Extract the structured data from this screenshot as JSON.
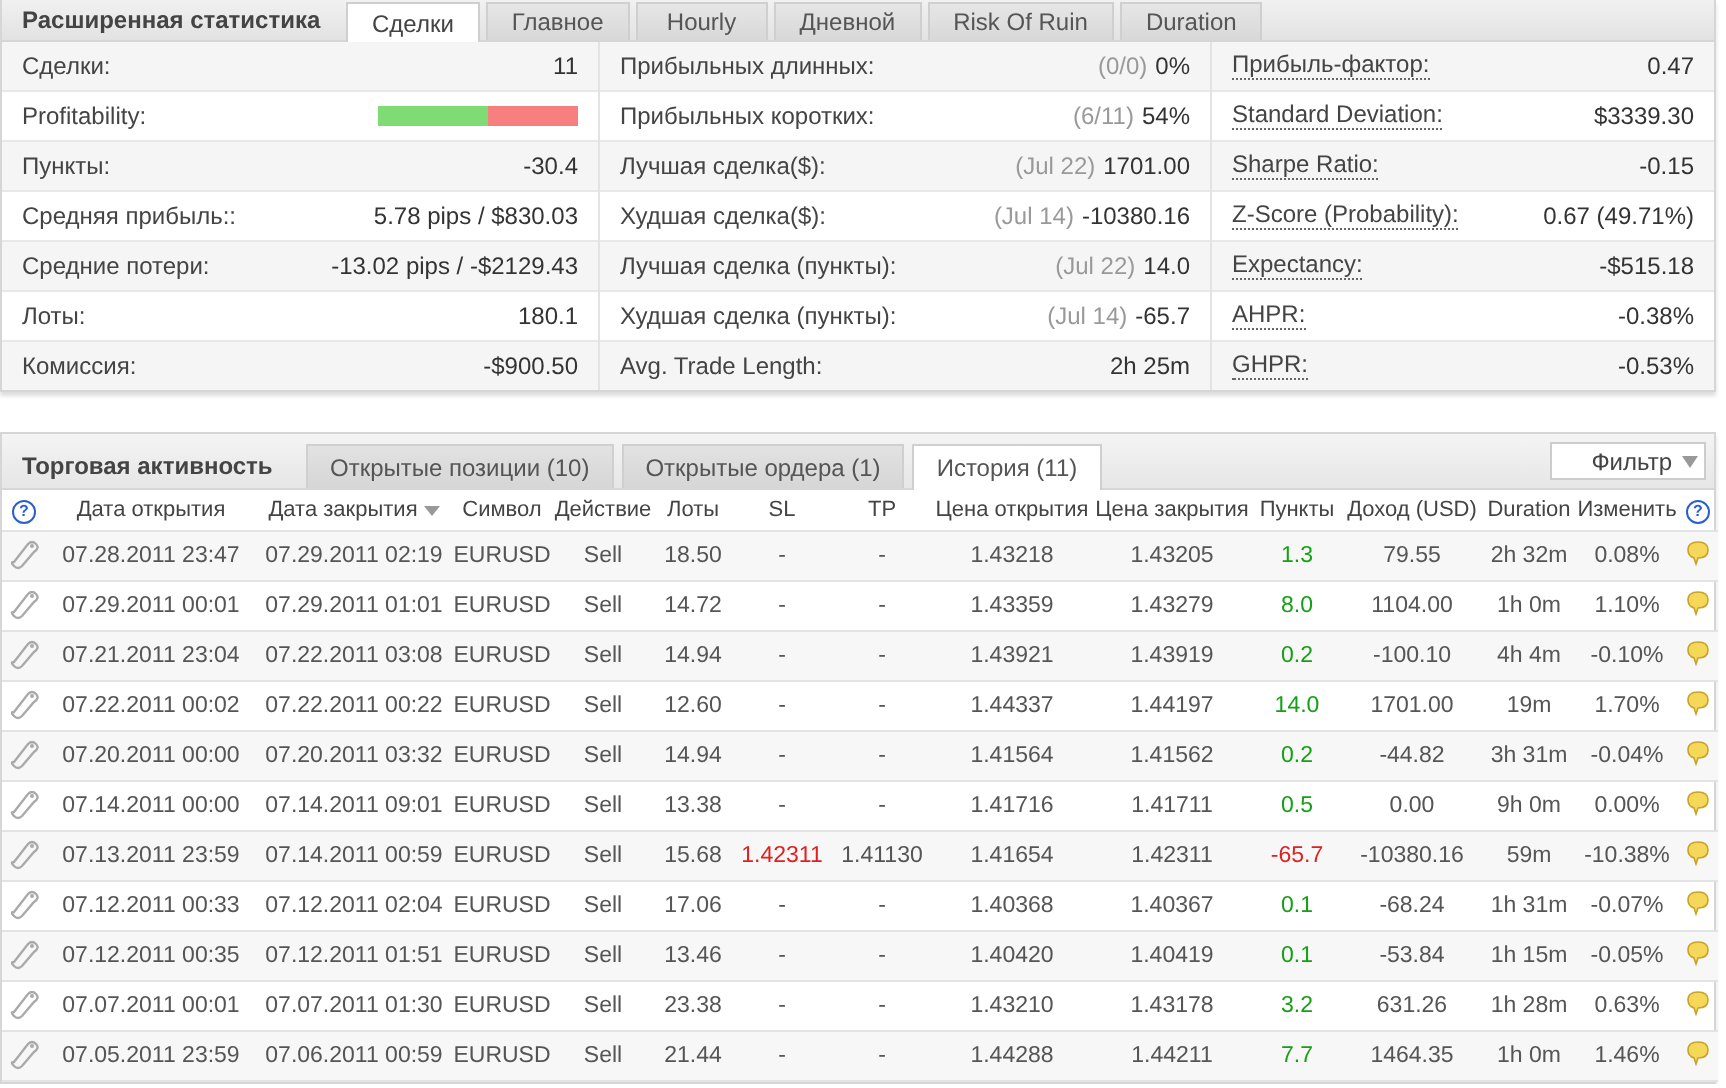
{
  "stats": {
    "title": "Расширенная статистика",
    "tabs": [
      {
        "label": "Сделки",
        "selected": true
      },
      {
        "label": "Главное",
        "selected": false
      },
      {
        "label": "Hourly",
        "selected": false
      },
      {
        "label": "Дневной",
        "selected": false
      },
      {
        "label": "Risk Of Ruin",
        "selected": false
      },
      {
        "label": "Duration",
        "selected": false
      }
    ],
    "columns": [
      {
        "items": [
          {
            "kind": "text",
            "label": "Сделки:",
            "value": "11"
          },
          {
            "kind": "bar",
            "label": "Profitability:",
            "level": 0.55
          },
          {
            "kind": "text",
            "label": "Пункты:",
            "value": "-30.4"
          },
          {
            "kind": "text",
            "label": "Средняя прибыль::",
            "value": "5.78 pips / $830.03"
          },
          {
            "kind": "text",
            "label": "Средние потери:",
            "value": "-13.02 pips / -$2129.43"
          },
          {
            "kind": "text",
            "label": "Лоты:",
            "value": "180.1"
          },
          {
            "kind": "text",
            "label": "Комиссия:",
            "value": "-$900.50"
          }
        ]
      },
      {
        "items": [
          {
            "kind": "noted",
            "label": "Прибыльных длинных:",
            "note": "(0/0)",
            "value": "0%"
          },
          {
            "kind": "noted",
            "label": "Прибыльных коротких:",
            "note": "(6/11)",
            "value": "54%"
          },
          {
            "kind": "noted",
            "label": "Лучшая сделка($):",
            "note": "(Jul 22)",
            "value": "1701.00"
          },
          {
            "kind": "noted",
            "label": "Худшая сделка($):",
            "note": "(Jul 14)",
            "value": "-10380.16"
          },
          {
            "kind": "noted",
            "label": "Лучшая сделка (пункты):",
            "note": "(Jul 22)",
            "value": "14.0"
          },
          {
            "kind": "noted",
            "label": "Худшая сделка (пункты):",
            "note": "(Jul 14)",
            "value": "-65.7"
          },
          {
            "kind": "text",
            "label": "Avg. Trade Length:",
            "value": "2h 25m"
          }
        ]
      },
      {
        "items": [
          {
            "kind": "hint",
            "label": "Прибыль-фактор:",
            "value": "0.47"
          },
          {
            "kind": "hint",
            "label": "Standard Deviation:",
            "value": "$3339.30"
          },
          {
            "kind": "hint",
            "label": "Sharpe Ratio:",
            "value": "-0.15"
          },
          {
            "kind": "hint",
            "label": "Z-Score (Probability):",
            "value": "0.67 (49.71%)"
          },
          {
            "kind": "hint",
            "label": "Expectancy:",
            "value": "-$515.18"
          },
          {
            "kind": "hint",
            "label": "AHPR:",
            "value": "-0.38%"
          },
          {
            "kind": "hint",
            "label": "GHPR:",
            "value": "-0.53%"
          }
        ]
      }
    ]
  },
  "trading": {
    "title": "Торговая активность",
    "tabs": [
      {
        "label": "Открытые позиции (10)",
        "selected": false
      },
      {
        "label": "Открытые ордера (1)",
        "selected": false
      },
      {
        "label": "История (11)",
        "selected": true
      }
    ],
    "filter": "Фильтр",
    "help_icons": [
      "?",
      "?"
    ],
    "columns": [
      {
        "label": "Дата открытия",
        "sorted": false
      },
      {
        "label": "Дата закрытия",
        "sorted": true
      },
      {
        "label": "Символ",
        "sorted": false
      },
      {
        "label": "Действие",
        "sorted": false
      },
      {
        "label": "Лоты",
        "sorted": false
      },
      {
        "label": "SL",
        "sorted": false
      },
      {
        "label": "TP",
        "sorted": false
      },
      {
        "label": "Цена открытия",
        "sorted": false
      },
      {
        "label": "Цена закрытия",
        "sorted": false
      },
      {
        "label": "Пункты",
        "sorted": false
      },
      {
        "label": "Доход (USD)",
        "sorted": false
      },
      {
        "label": "Duration",
        "sorted": false
      },
      {
        "label": "Изменить",
        "sorted": false
      }
    ],
    "rows": [
      {
        "open": "07.28.2011 23:47",
        "close": "07.29.2011 02:19",
        "symbol": "EURUSD",
        "action": "Sell",
        "lots": "18.50",
        "sl": "-",
        "tp": "-",
        "open_price": "1.43218",
        "close_price": "1.43205",
        "pips": "1.3",
        "income": "79.55",
        "duration": "2h 32m",
        "change": "0.08%",
        "profit": true,
        "sl_hit": false
      },
      {
        "open": "07.29.2011 00:01",
        "close": "07.29.2011 01:01",
        "symbol": "EURUSD",
        "action": "Sell",
        "lots": "14.72",
        "sl": "-",
        "tp": "-",
        "open_price": "1.43359",
        "close_price": "1.43279",
        "pips": "8.0",
        "income": "1104.00",
        "duration": "1h 0m",
        "change": "1.10%",
        "profit": true,
        "sl_hit": false
      },
      {
        "open": "07.21.2011 23:04",
        "close": "07.22.2011 03:08",
        "symbol": "EURUSD",
        "action": "Sell",
        "lots": "14.94",
        "sl": "-",
        "tp": "-",
        "open_price": "1.43921",
        "close_price": "1.43919",
        "pips": "0.2",
        "income": "-100.10",
        "duration": "4h 4m",
        "change": "-0.10%",
        "profit": true,
        "sl_hit": false
      },
      {
        "open": "07.22.2011 00:02",
        "close": "07.22.2011 00:22",
        "symbol": "EURUSD",
        "action": "Sell",
        "lots": "12.60",
        "sl": "-",
        "tp": "-",
        "open_price": "1.44337",
        "close_price": "1.44197",
        "pips": "14.0",
        "income": "1701.00",
        "duration": "19m",
        "change": "1.70%",
        "profit": true,
        "sl_hit": false
      },
      {
        "open": "07.20.2011 00:00",
        "close": "07.20.2011 03:32",
        "symbol": "EURUSD",
        "action": "Sell",
        "lots": "14.94",
        "sl": "-",
        "tp": "-",
        "open_price": "1.41564",
        "close_price": "1.41562",
        "pips": "0.2",
        "income": "-44.82",
        "duration": "3h 31m",
        "change": "-0.04%",
        "profit": true,
        "sl_hit": false
      },
      {
        "open": "07.14.2011 00:00",
        "close": "07.14.2011 09:01",
        "symbol": "EURUSD",
        "action": "Sell",
        "lots": "13.38",
        "sl": "-",
        "tp": "-",
        "open_price": "1.41716",
        "close_price": "1.41711",
        "pips": "0.5",
        "income": "0.00",
        "duration": "9h 0m",
        "change": "0.00%",
        "profit": true,
        "sl_hit": false
      },
      {
        "open": "07.13.2011 23:59",
        "close": "07.14.2011 00:59",
        "symbol": "EURUSD",
        "action": "Sell",
        "lots": "15.68",
        "sl": "1.42311",
        "tp": "1.41130",
        "open_price": "1.41654",
        "close_price": "1.42311",
        "pips": "-65.7",
        "income": "-10380.16",
        "duration": "59m",
        "change": "-10.38%",
        "profit": false,
        "sl_hit": true
      },
      {
        "open": "07.12.2011 00:33",
        "close": "07.12.2011 02:04",
        "symbol": "EURUSD",
        "action": "Sell",
        "lots": "17.06",
        "sl": "-",
        "tp": "-",
        "open_price": "1.40368",
        "close_price": "1.40367",
        "pips": "0.1",
        "income": "-68.24",
        "duration": "1h 31m",
        "change": "-0.07%",
        "profit": true,
        "sl_hit": false
      },
      {
        "open": "07.12.2011 00:35",
        "close": "07.12.2011 01:51",
        "symbol": "EURUSD",
        "action": "Sell",
        "lots": "13.46",
        "sl": "-",
        "tp": "-",
        "open_price": "1.40420",
        "close_price": "1.40419",
        "pips": "0.1",
        "income": "-53.84",
        "duration": "1h 15m",
        "change": "-0.05%",
        "profit": true,
        "sl_hit": false
      },
      {
        "open": "07.07.2011 00:01",
        "close": "07.07.2011 01:30",
        "symbol": "EURUSD",
        "action": "Sell",
        "lots": "23.38",
        "sl": "-",
        "tp": "-",
        "open_price": "1.43210",
        "close_price": "1.43178",
        "pips": "3.2",
        "income": "631.26",
        "duration": "1h 28m",
        "change": "0.63%",
        "profit": true,
        "sl_hit": false
      },
      {
        "open": "07.05.2011 23:59",
        "close": "07.06.2011 00:59",
        "symbol": "EURUSD",
        "action": "Sell",
        "lots": "21.44",
        "sl": "-",
        "tp": "-",
        "open_price": "1.44288",
        "close_price": "1.44211",
        "pips": "7.7",
        "income": "1464.35",
        "duration": "1h 0m",
        "change": "1.46%",
        "profit": true,
        "sl_hit": false
      }
    ]
  }
}
